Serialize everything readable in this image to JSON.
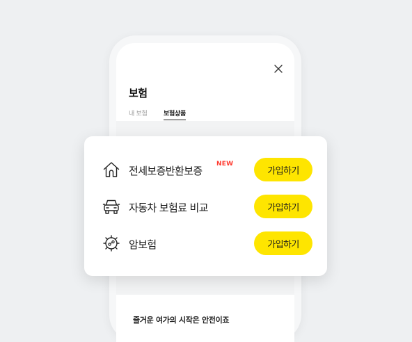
{
  "screen": {
    "title": "보험",
    "tabs": [
      {
        "label": "내 보험"
      },
      {
        "label": "보험상품"
      }
    ],
    "headline": "즐거운 여가의 시작은 안전이죠"
  },
  "card": {
    "items": [
      {
        "label": "전세보증반환보증",
        "badge": "NEW",
        "button": "가입하기",
        "icon": "house-icon"
      },
      {
        "label": "자동차 보험료 비교",
        "button": "가입하기",
        "icon": "car-icon"
      },
      {
        "label": "암보험",
        "button": "가입하기",
        "icon": "virus-icon"
      }
    ]
  },
  "colors": {
    "accent": "#fee500",
    "badge": "#ff3b30",
    "background": "#eef0f2"
  }
}
